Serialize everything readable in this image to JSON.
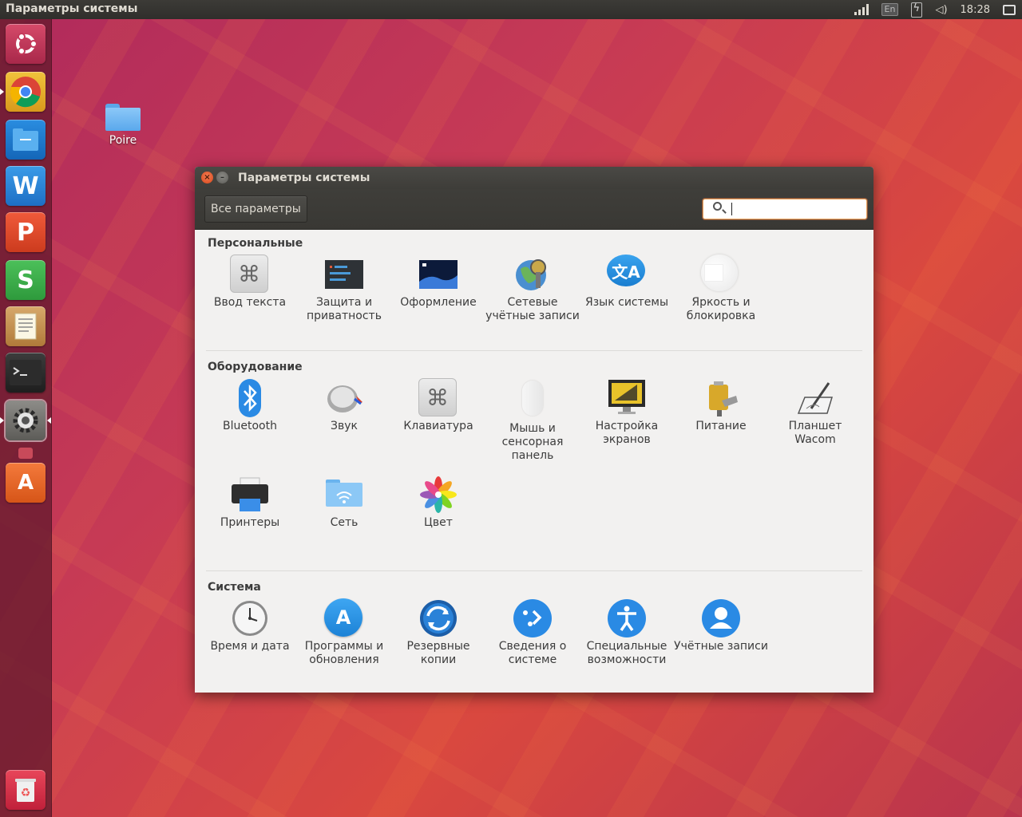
{
  "topbar": {
    "title": "Параметры системы",
    "lang": "En",
    "clock": "18:28"
  },
  "launcher": {
    "items": [
      {
        "name": "ubuntu-dash"
      },
      {
        "name": "chrome"
      },
      {
        "name": "files"
      },
      {
        "name": "wps-writer"
      },
      {
        "name": "wps-presentation"
      },
      {
        "name": "wps-spreadsheets"
      },
      {
        "name": "text-editor"
      },
      {
        "name": "terminal"
      },
      {
        "name": "system-settings"
      },
      {
        "name": "software-center"
      },
      {
        "name": "trash"
      }
    ]
  },
  "desktop": {
    "folder_label": "Poire"
  },
  "window": {
    "title": "Параметры системы",
    "all_button": "Все параметры",
    "search_placeholder": "",
    "sections": [
      {
        "title": "Персональные",
        "items": [
          {
            "label": "Ввод текста",
            "icon": "text-entry-icon"
          },
          {
            "label": "Защита и приватность",
            "icon": "security-privacy-icon"
          },
          {
            "label": "Оформление",
            "icon": "appearance-icon"
          },
          {
            "label": "Сетевые учётные записи",
            "icon": "online-accounts-icon"
          },
          {
            "label": "Язык системы",
            "icon": "language-icon"
          },
          {
            "label": "Яркость и блокировка",
            "icon": "brightness-lock-icon"
          }
        ]
      },
      {
        "title": "Оборудование",
        "items": [
          {
            "label": "Bluetooth",
            "icon": "bluetooth-icon"
          },
          {
            "label": "Звук",
            "icon": "sound-icon"
          },
          {
            "label": "Клавиатура",
            "icon": "keyboard-icon"
          },
          {
            "label": "Мышь и сенсорная панель",
            "icon": "mouse-touchpad-icon"
          },
          {
            "label": "Настройка экранов",
            "icon": "displays-icon"
          },
          {
            "label": "Питание",
            "icon": "power-icon"
          },
          {
            "label": "Планшет Wacom",
            "icon": "wacom-tablet-icon"
          },
          {
            "label": "Принтеры",
            "icon": "printers-icon"
          },
          {
            "label": "Сеть",
            "icon": "network-icon"
          },
          {
            "label": "Цвет",
            "icon": "color-icon"
          }
        ]
      },
      {
        "title": "Система",
        "items": [
          {
            "label": "Время и дата",
            "icon": "time-date-icon"
          },
          {
            "label": "Программы и обновления",
            "icon": "software-updates-icon"
          },
          {
            "label": "Резервные копии",
            "icon": "backups-icon"
          },
          {
            "label": "Сведения о системе",
            "icon": "details-icon"
          },
          {
            "label": "Специальные возможности",
            "icon": "accessibility-icon"
          },
          {
            "label": "Учётные записи",
            "icon": "user-accounts-icon"
          }
        ]
      }
    ]
  },
  "colors": {
    "accent": "#e95420",
    "panel": "#3c3b37",
    "window_bg": "#f2f1f0",
    "launcher": "#64192d"
  }
}
